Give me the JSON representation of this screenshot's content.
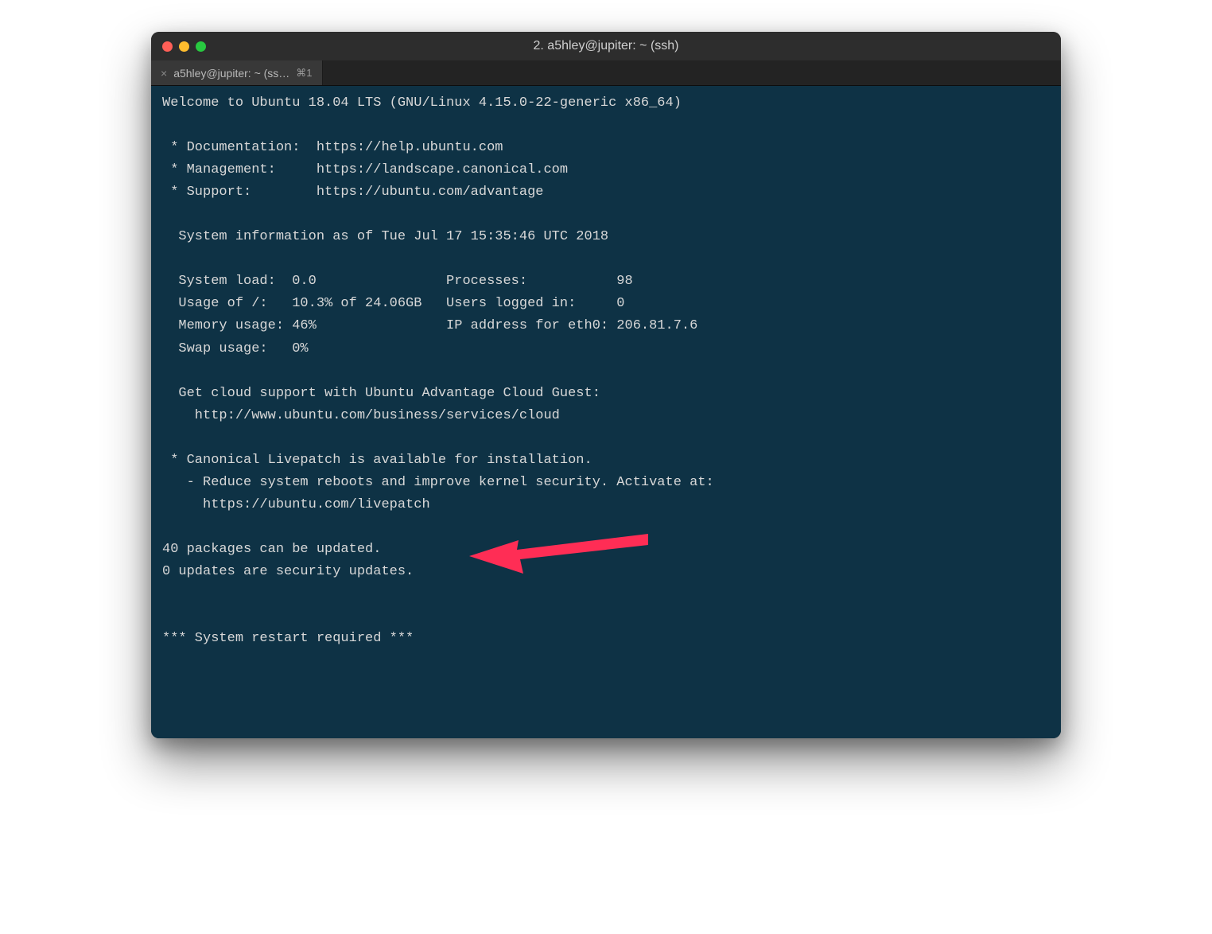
{
  "window": {
    "title": "2. a5hley@jupiter: ~ (ssh)"
  },
  "tab": {
    "label": "a5hley@jupiter: ~ (ss…",
    "shortcut": "⌘1"
  },
  "motd": {
    "welcome": "Welcome to Ubuntu 18.04 LTS (GNU/Linux 4.15.0-22-generic x86_64)",
    "links": {
      "doc_label": " * Documentation:  https://help.ubuntu.com",
      "mgmt_label": " * Management:     https://landscape.canonical.com",
      "support_label": " * Support:        https://ubuntu.com/advantage"
    },
    "sysinfo_header": "  System information as of Tue Jul 17 15:35:46 UTC 2018",
    "sysinfo": {
      "row1": "  System load:  0.0                Processes:           98",
      "row2": "  Usage of /:   10.3% of 24.06GB   Users logged in:     0",
      "row3": "  Memory usage: 46%                IP address for eth0: 206.81.7.6",
      "row4": "  Swap usage:   0%"
    },
    "cloud": {
      "line1": "  Get cloud support with Ubuntu Advantage Cloud Guest:",
      "line2": "    http://www.ubuntu.com/business/services/cloud"
    },
    "livepatch": {
      "line1": " * Canonical Livepatch is available for installation.",
      "line2": "   - Reduce system reboots and improve kernel security. Activate at:",
      "line3": "     https://ubuntu.com/livepatch"
    },
    "updates": {
      "packages": "40 packages can be updated.",
      "security": "0 updates are security updates."
    },
    "restart": "*** System restart required ***"
  },
  "annotation": {
    "arrow_color": "#ff2d55"
  }
}
